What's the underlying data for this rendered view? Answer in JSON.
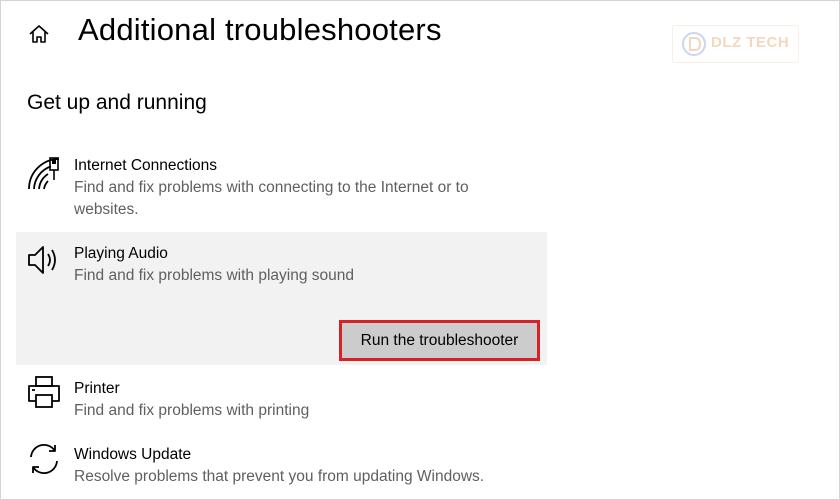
{
  "header": {
    "title": "Additional troubleshooters",
    "home_icon": "home-icon"
  },
  "watermark": {
    "text": "DLZ TECH",
    "color": "#e8b98a"
  },
  "section": {
    "heading": "Get up and running"
  },
  "items": [
    {
      "icon": "wifi-network-icon",
      "title": "Internet Connections",
      "description": "Find and fix problems with connecting to the Internet or to websites."
    },
    {
      "icon": "speaker-icon",
      "title": "Playing Audio",
      "description": "Find and fix problems with playing sound",
      "selected": true,
      "action_label": "Run the troubleshooter"
    },
    {
      "icon": "printer-icon",
      "title": "Printer",
      "description": "Find and fix problems with printing"
    },
    {
      "icon": "refresh-sync-icon",
      "title": "Windows Update",
      "description": "Resolve problems that prevent you from updating Windows."
    }
  ],
  "colors": {
    "selected_background": "#f2f2f2",
    "button_background": "#cccccc",
    "highlight_border": "#d92027",
    "secondary_text": "#5f5f5f"
  }
}
